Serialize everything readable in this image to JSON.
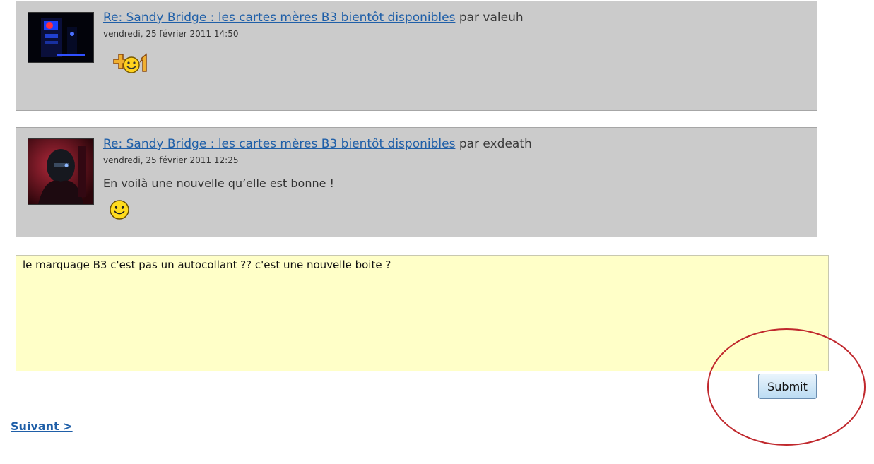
{
  "comments": [
    {
      "title": "Re: Sandy Bridge : les cartes mères B3 bientôt disponibles",
      "by": "par valeuh",
      "date": "vendredi, 25 février 2011 14:50",
      "text": "",
      "emoji": "plus-one-smiley-icon"
    },
    {
      "title": "Re: Sandy Bridge : les cartes mères B3 bientôt disponibles",
      "by": "par exdeath",
      "date": "vendredi, 25 février 2011 12:25",
      "text": "En voilà une nouvelle qu’elle est bonne !",
      "emoji": "smiley-icon"
    }
  ],
  "reply": {
    "value": "le marquage B3 c'est pas un autocollant ?? c'est une nouvelle boite ?"
  },
  "submit_label": "Submit",
  "next_link": "Suivant >",
  "colors": {
    "comment_bg": "#cbcbcb",
    "link": "#1f5fa8",
    "reply_bg": "#ffffc8",
    "annotation_circle": "#c0282d"
  }
}
